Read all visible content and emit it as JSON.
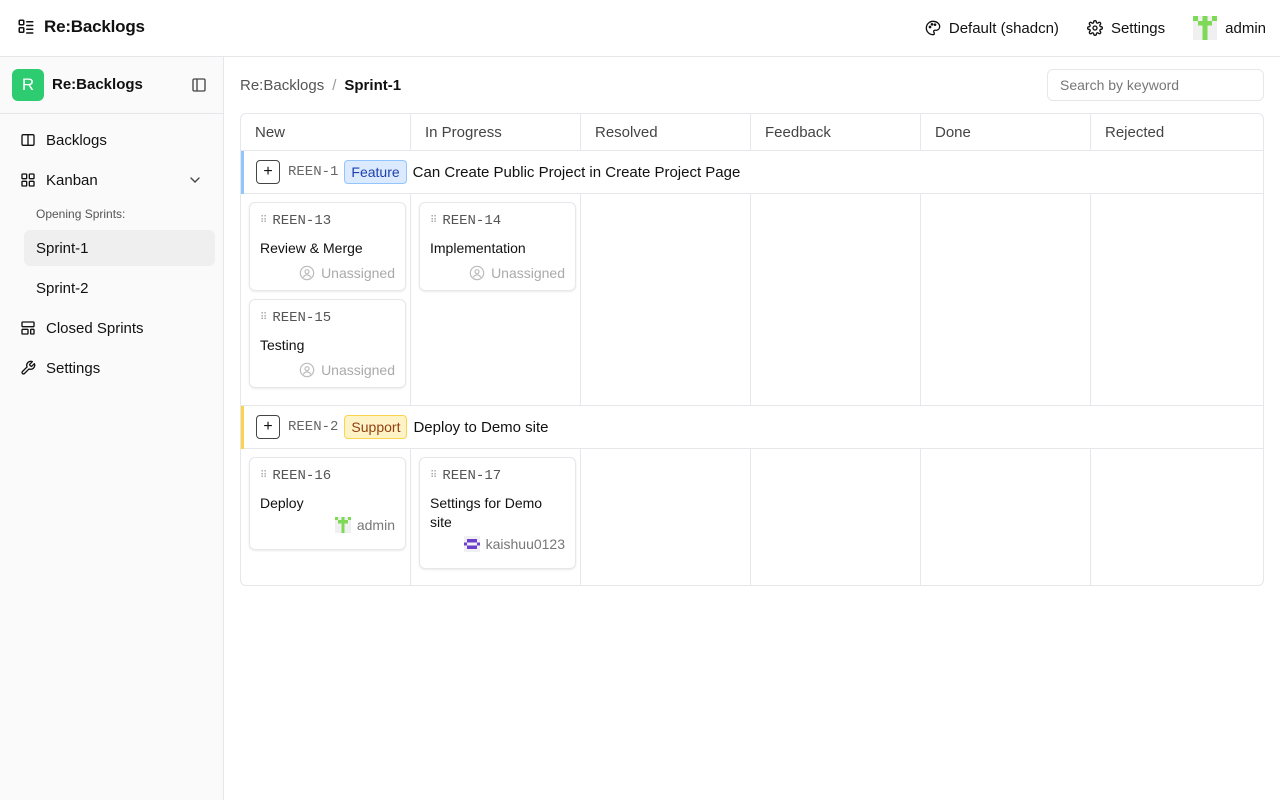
{
  "header": {
    "brand": "Re:Backlogs",
    "theme_label": "Default (shadcn)",
    "settings_label": "Settings",
    "user_label": "admin"
  },
  "sidebar": {
    "logo_letter": "R",
    "title": "Re:Backlogs",
    "items": [
      {
        "label": "Backlogs",
        "icon": "book-open-icon"
      },
      {
        "label": "Kanban",
        "icon": "layout-grid-icon"
      },
      {
        "label": "Closed Sprints",
        "icon": "layout-template-icon"
      },
      {
        "label": "Settings",
        "icon": "wrench-icon"
      }
    ],
    "sub_heading": "Opening Sprints:",
    "sprints": [
      {
        "label": "Sprint-1",
        "active": true
      },
      {
        "label": "Sprint-2",
        "active": false
      }
    ]
  },
  "breadcrumb": {
    "root": "Re:Backlogs",
    "separator": "/",
    "current": "Sprint-1"
  },
  "search": {
    "placeholder": "Search by keyword"
  },
  "board": {
    "columns": [
      "New",
      "In Progress",
      "Resolved",
      "Feedback",
      "Done",
      "Rejected"
    ],
    "stories": [
      {
        "id": "REEN-1",
        "tag": "Feature",
        "title": "Can Create Public Project in Create Project Page",
        "accent": "#93c5fd",
        "cards": {
          "new": [
            {
              "id": "REEN-13",
              "title": "Review & Merge",
              "assignee": "Unassigned"
            },
            {
              "id": "REEN-15",
              "title": "Testing",
              "assignee": "Unassigned"
            }
          ],
          "in_progress": [
            {
              "id": "REEN-14",
              "title": "Implementation",
              "assignee": "Unassigned"
            }
          ]
        }
      },
      {
        "id": "REEN-2",
        "tag": "Support",
        "title": "Deploy to Demo site",
        "accent": "#fcd34d",
        "cards": {
          "new": [
            {
              "id": "REEN-16",
              "title": "Deploy",
              "assignee": "admin"
            }
          ],
          "in_progress": [
            {
              "id": "REEN-17",
              "title": "Settings for Demo site",
              "assignee": "kaishuu0123"
            }
          ]
        }
      }
    ]
  }
}
